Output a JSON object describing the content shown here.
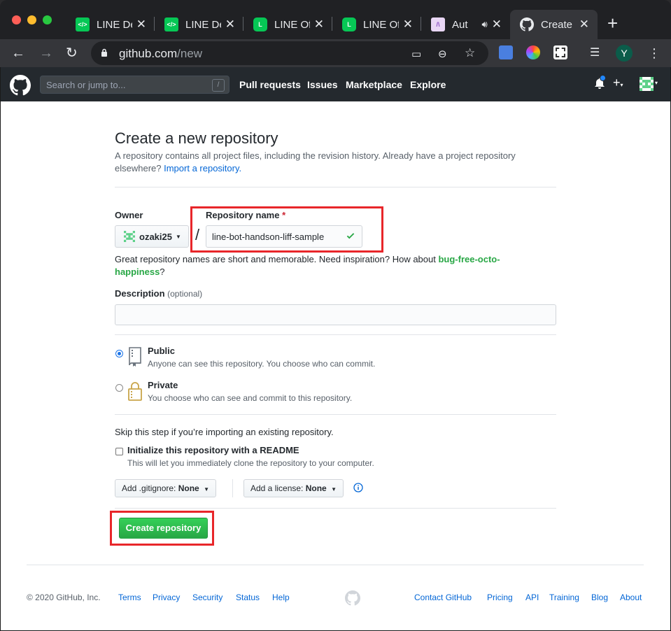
{
  "browser": {
    "tabs": [
      {
        "title": "LINE De",
        "icon": "code-icon"
      },
      {
        "title": "LINE De",
        "icon": "code-icon"
      },
      {
        "title": "LINE Of",
        "icon": "line-shield-icon"
      },
      {
        "title": "LINE Of",
        "icon": "line-shield-icon"
      },
      {
        "title": "Aut",
        "icon": "aut-icon"
      },
      {
        "title": "Create",
        "icon": "github-icon"
      }
    ],
    "url_host": "github.com",
    "url_path": "/new",
    "profile_initial": "Y"
  },
  "header": {
    "search_placeholder": "Search or jump to...",
    "search_shortcut": "/",
    "nav": [
      "Pull requests",
      "Issues",
      "Marketplace",
      "Explore"
    ],
    "plus_label": "+"
  },
  "form": {
    "title": "Create a new repository",
    "subtitle_line1": "A repository contains all project files, including the revision history. Already have a project repository",
    "subtitle_line2_prefix": "elsewhere? ",
    "import_link": "Import a repository.",
    "owner_label": "Owner",
    "owner_value": "ozaki25",
    "repo_label": "Repository name",
    "required_mark": "*",
    "slash": "/",
    "repo_value": "line-bot-handson-liff-sample",
    "hint_prefix": "Great repository names are short and memorable. Need inspiration? How about ",
    "hint_suggestion_1": "bug-free-octo-",
    "hint_suggestion_2": "happiness",
    "hint_suffix": "?",
    "desc_label": "Description",
    "desc_optional": "(optional)",
    "public_title": "Public",
    "public_desc": "Anyone can see this repository. You choose who can commit.",
    "private_title": "Private",
    "private_desc": "You choose who can see and commit to this repository.",
    "skip_text": "Skip this step if you’re importing an existing repository.",
    "init_label": "Initialize this repository with a README",
    "init_desc": "This will let you immediately clone the repository to your computer.",
    "gitignore_label": "Add .gitignore: ",
    "gitignore_value": "None",
    "license_label": "Add a license: ",
    "license_value": "None",
    "create_button": "Create repository"
  },
  "footer": {
    "copyright": "© 2020 GitHub, Inc.",
    "left_links": [
      "Terms",
      "Privacy",
      "Security",
      "Status",
      "Help"
    ],
    "right_links": [
      "Contact GitHub",
      "Pricing",
      "API",
      "Training",
      "Blog",
      "About"
    ]
  },
  "colors": {
    "accent_red": "#e8262a",
    "github_dark": "#24292e",
    "green": "#28a745",
    "link_blue": "#0366d6"
  }
}
